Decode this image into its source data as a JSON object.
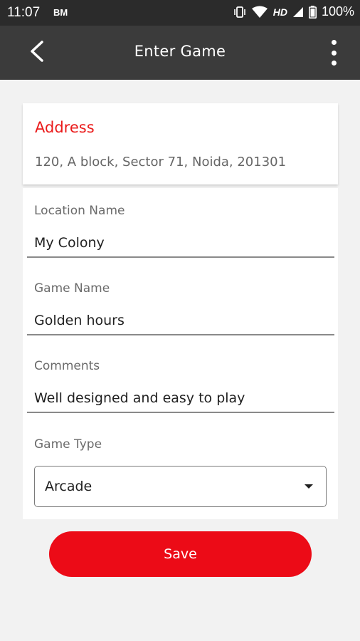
{
  "status_bar": {
    "time": "11:07",
    "extra": "BM",
    "network": "HD",
    "battery": "100%"
  },
  "app_bar": {
    "title": "Enter Game"
  },
  "address": {
    "label": "Address",
    "value": "120, A block, Sector 71, Noida, 201301"
  },
  "fields": {
    "location": {
      "label": "Location Name",
      "value": "My Colony"
    },
    "game": {
      "label": "Game Name",
      "value": "Golden hours"
    },
    "comments": {
      "label": "Comments",
      "value": "Well designed and easy to play"
    },
    "type": {
      "label": "Game Type",
      "value": "Arcade"
    }
  },
  "save_label": "Save",
  "colors": {
    "accent": "#ec0b17",
    "app_bar": "#3b3b3b",
    "status_bar": "#2b2b2b",
    "background": "#f2f2f2"
  },
  "icons": {
    "back": "back-arrow-icon",
    "more": "more-vert-icon",
    "dropdown": "dropdown-arrow-icon"
  }
}
